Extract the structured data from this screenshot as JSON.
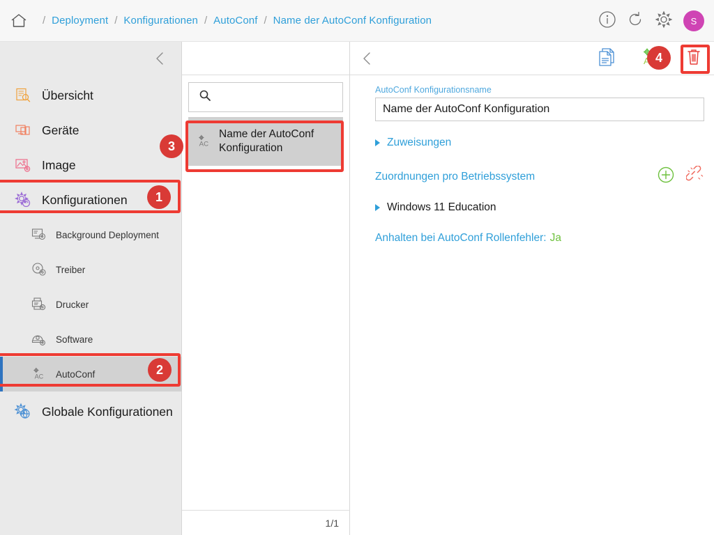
{
  "breadcrumb": {
    "home_icon": "home-icon",
    "items": [
      "Deployment",
      "Konfigurationen",
      "AutoConf",
      "Name der AutoConf Konfiguration"
    ],
    "separator": "/"
  },
  "topbar": {
    "info_icon": "info-icon",
    "refresh_icon": "refresh-icon",
    "settings_icon": "gear-icon",
    "avatar_initial": "S",
    "avatar_color": "#cf44b4"
  },
  "sidebar": {
    "collapse_icon": "chevron-left-icon",
    "items": [
      {
        "label": "Übersicht",
        "icon": "overview-icon",
        "color": "#f0a23c",
        "level": "main",
        "selected": false
      },
      {
        "label": "Geräte",
        "icon": "devices-icon",
        "color": "#f08060",
        "level": "main",
        "selected": false
      },
      {
        "label": "Image",
        "icon": "image-icon",
        "color": "#ee6b8a",
        "level": "main",
        "selected": false
      },
      {
        "label": "Konfigurationen",
        "icon": "configurations-gear-icon",
        "color": "#9b6bd6",
        "level": "main",
        "selected": false
      },
      {
        "label": "Background Deployment",
        "icon": "background-deployment-icon",
        "color": "#7a7a7a",
        "level": "sub",
        "selected": false
      },
      {
        "label": "Treiber",
        "icon": "driver-disc-icon",
        "color": "#7a7a7a",
        "level": "sub",
        "selected": false
      },
      {
        "label": "Drucker",
        "icon": "printer-icon",
        "color": "#7a7a7a",
        "level": "sub",
        "selected": false
      },
      {
        "label": "Software",
        "icon": "software-disc-icon",
        "color": "#7a7a7a",
        "level": "sub",
        "selected": false
      },
      {
        "label": "AutoConf",
        "icon": "autoconf-icon",
        "color": "#7a7a7a",
        "level": "sub",
        "selected": true
      },
      {
        "label": "Globale Konfigurationen",
        "icon": "global-configurations-icon",
        "color": "#4a8fd4",
        "level": "main",
        "selected": false
      }
    ]
  },
  "list_panel": {
    "search": {
      "placeholder": "",
      "value": "",
      "icon": "search-icon"
    },
    "items": [
      {
        "label": "Name der AutoConf Konfiguration",
        "icon": "autoconf-icon",
        "selected": true
      }
    ],
    "pagination": "1/1"
  },
  "detail": {
    "back_icon": "chevron-left-icon",
    "actions": [
      {
        "name": "duplicate-icon",
        "label": ""
      },
      {
        "name": "autoconf-gear-icon",
        "label": ""
      },
      {
        "name": "delete-trash-icon",
        "label": ""
      }
    ],
    "name_field": {
      "label": "AutoConf Konfigurationsname",
      "value": "Name der AutoConf Konfiguration"
    },
    "assignments_expander": "Zuweisungen",
    "os_section": {
      "label": "Zuordnungen pro Betriebssystem",
      "add_icon": "plus-circle-icon",
      "link_icon": "unlink-icon",
      "entries": [
        "Windows 11 Education"
      ]
    },
    "halt_on_error": {
      "label": "Anhalten bei AutoConf Rollenfehler:",
      "value": "Ja"
    }
  },
  "annotations": {
    "badges": [
      "1",
      "2",
      "3",
      "4"
    ],
    "highlight_color": "#ee3b33",
    "badge_color": "#d93a36"
  }
}
